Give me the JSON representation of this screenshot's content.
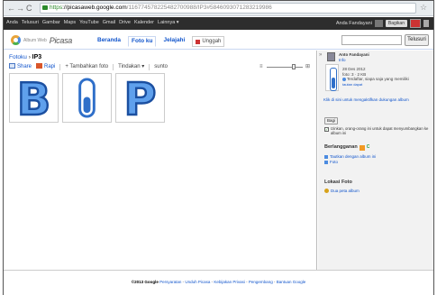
{
  "browser": {
    "url_scheme": "https",
    "url_host": "://picasaweb.google.com",
    "url_path": "/116774578225482700988/IP3#5846093071283219986"
  },
  "google_bar": {
    "links": [
      "Anda",
      "Telusuri",
      "Gambar",
      "Maps",
      "YouTube",
      "Gmail",
      "Drive",
      "Kalender",
      "Lainnya ▾"
    ],
    "account": "Anda Fandayani",
    "share_button": "Bagikan"
  },
  "header": {
    "logo_small": "Album Web",
    "logo_text": "Picasa",
    "tabs": [
      "Beranda",
      "Foto ku",
      "Jelajahi"
    ],
    "upload_label": "Unggah",
    "search_placeholder": "",
    "search_button": "Telusuri"
  },
  "breadcrumb": {
    "parent": "Fotoku",
    "separator": "›",
    "current": "IP3"
  },
  "toolbar": {
    "share": "Share",
    "edit": "Rapi",
    "add_photos": "Tambahkan foto",
    "actions": "Tindakan ▾",
    "sort": "sunto"
  },
  "zoom": {
    "level": 0.75
  },
  "photos": [
    {
      "letter": "B",
      "kind": "letter"
    },
    {
      "letter": "I",
      "kind": "thermometer"
    },
    {
      "letter": "P",
      "kind": "letter"
    }
  ],
  "sidebar": {
    "owner_name": "Anto Fandayani",
    "owner_sub": "Info",
    "date": "28 Des 2012",
    "count": "foto: 3 · 2 KB",
    "visibility": "Terdaftar, siapa saja yang memiliki",
    "visibility_link": "tautan dapat",
    "album_link": "Klik di sini untuk mengaktifkan dukungan album",
    "share_button": "Bagi",
    "checkbox_mark": "✓",
    "checkbox_text": "Izinkan, orang-orang ini untuk dapat menyumbangkan ke album ini",
    "subscribe_heading": "Berlangganan",
    "rss_label": "C",
    "links": [
      "Tautkan dengan album ini",
      "Foto"
    ],
    "location_heading": "Lokasi Foto",
    "location_link": "Dua peta album"
  },
  "footer": {
    "copyright": "©2013 Google",
    "links": [
      "Persyaratan",
      "Unduh Picasa",
      "Kebijakan Privasi",
      "Pengembang",
      "Bantuan Google"
    ]
  }
}
